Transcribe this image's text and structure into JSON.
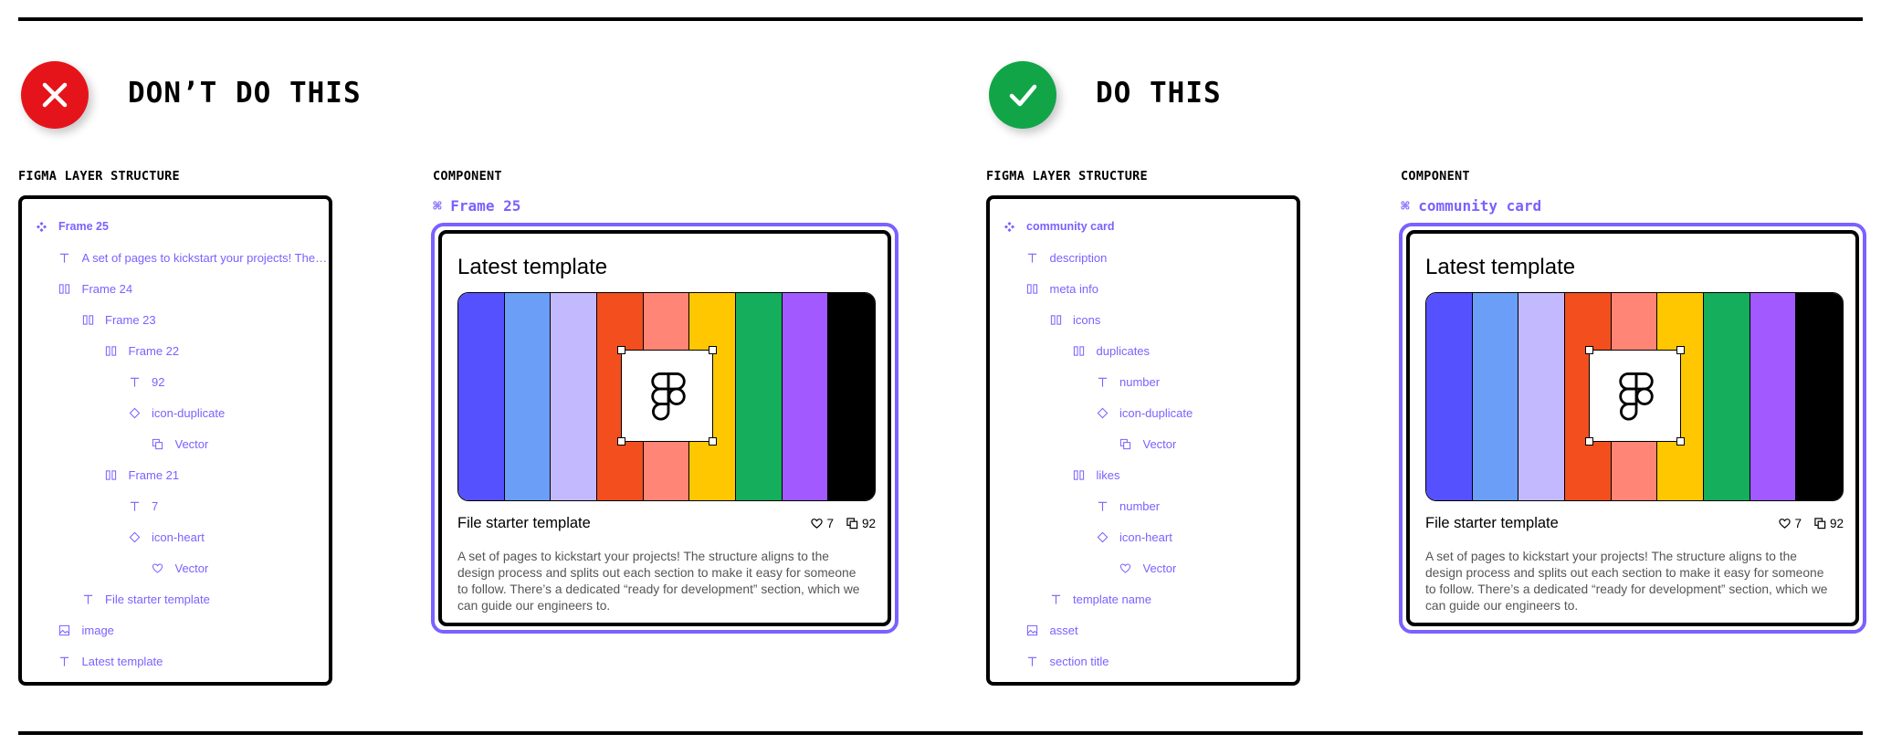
{
  "colors": {
    "accent": "#7b61ff",
    "bad": "#e5141b",
    "good": "#11a548",
    "stripes": [
      "#5551ff",
      "#6a9ef7",
      "#c3b9ff",
      "#f24e1e",
      "#ff8577",
      "#ffc700",
      "#14ae5c",
      "#a259ff",
      "#000000"
    ]
  },
  "bad": {
    "heading": "DON’T DO THIS",
    "layers_label": "FIGMA LAYER STRUCTURE",
    "component_label": "COMPONENT",
    "component_name": "Frame 25",
    "layers": [
      {
        "name": "Frame 25",
        "icon": "component-icon",
        "depth": 0
      },
      {
        "name": "A set of pages to kickstart your projects! The s...",
        "icon": "text-icon",
        "depth": 1
      },
      {
        "name": "Frame 24",
        "icon": "auto-layout-icon",
        "depth": 1
      },
      {
        "name": "Frame 23",
        "icon": "auto-layout-icon",
        "depth": 2
      },
      {
        "name": "Frame 22",
        "icon": "auto-layout-icon",
        "depth": 3
      },
      {
        "name": "92",
        "icon": "text-icon",
        "depth": 4
      },
      {
        "name": "icon-duplicate",
        "icon": "instance-icon",
        "depth": 4
      },
      {
        "name": "Vector",
        "icon": "duplicate-icon",
        "depth": 5
      },
      {
        "name": "Frame 21",
        "icon": "auto-layout-icon",
        "depth": 3
      },
      {
        "name": "7",
        "icon": "text-icon",
        "depth": 4
      },
      {
        "name": "icon-heart",
        "icon": "instance-icon",
        "depth": 4
      },
      {
        "name": "Vector",
        "icon": "heart-icon",
        "depth": 5
      },
      {
        "name": "File starter template",
        "icon": "text-icon",
        "depth": 2
      },
      {
        "name": "image",
        "icon": "image-icon",
        "depth": 1
      },
      {
        "name": "Latest template",
        "icon": "text-icon",
        "depth": 1
      }
    ]
  },
  "good": {
    "heading": "DO THIS",
    "layers_label": "FIGMA LAYER STRUCTURE",
    "component_label": "COMPONENT",
    "component_name": "community card",
    "layers": [
      {
        "name": "community card",
        "icon": "component-icon",
        "depth": 0
      },
      {
        "name": "description",
        "icon": "text-icon",
        "depth": 1
      },
      {
        "name": "meta info",
        "icon": "auto-layout-icon",
        "depth": 1
      },
      {
        "name": "icons",
        "icon": "auto-layout-icon",
        "depth": 2
      },
      {
        "name": "duplicates",
        "icon": "auto-layout-icon",
        "depth": 3
      },
      {
        "name": "number",
        "icon": "text-icon",
        "depth": 4
      },
      {
        "name": "icon-duplicate",
        "icon": "instance-icon",
        "depth": 4
      },
      {
        "name": "Vector",
        "icon": "duplicate-icon",
        "depth": 5
      },
      {
        "name": "likes",
        "icon": "auto-layout-icon",
        "depth": 3
      },
      {
        "name": "number",
        "icon": "text-icon",
        "depth": 4
      },
      {
        "name": "icon-heart",
        "icon": "instance-icon",
        "depth": 4
      },
      {
        "name": "Vector",
        "icon": "heart-icon",
        "depth": 5
      },
      {
        "name": "template name",
        "icon": "text-icon",
        "depth": 2
      },
      {
        "name": "asset",
        "icon": "image-icon",
        "depth": 1
      },
      {
        "name": "section title",
        "icon": "text-icon",
        "depth": 1
      }
    ]
  },
  "card": {
    "title": "Latest template",
    "template_name": "File starter template",
    "likes": "7",
    "duplicates": "92",
    "description": "A set of pages to kickstart your projects! The structure aligns to the design process and splits out each section to make it easy for someone to follow. There’s a dedicated “ready for development” section, which we can guide our engineers to."
  }
}
